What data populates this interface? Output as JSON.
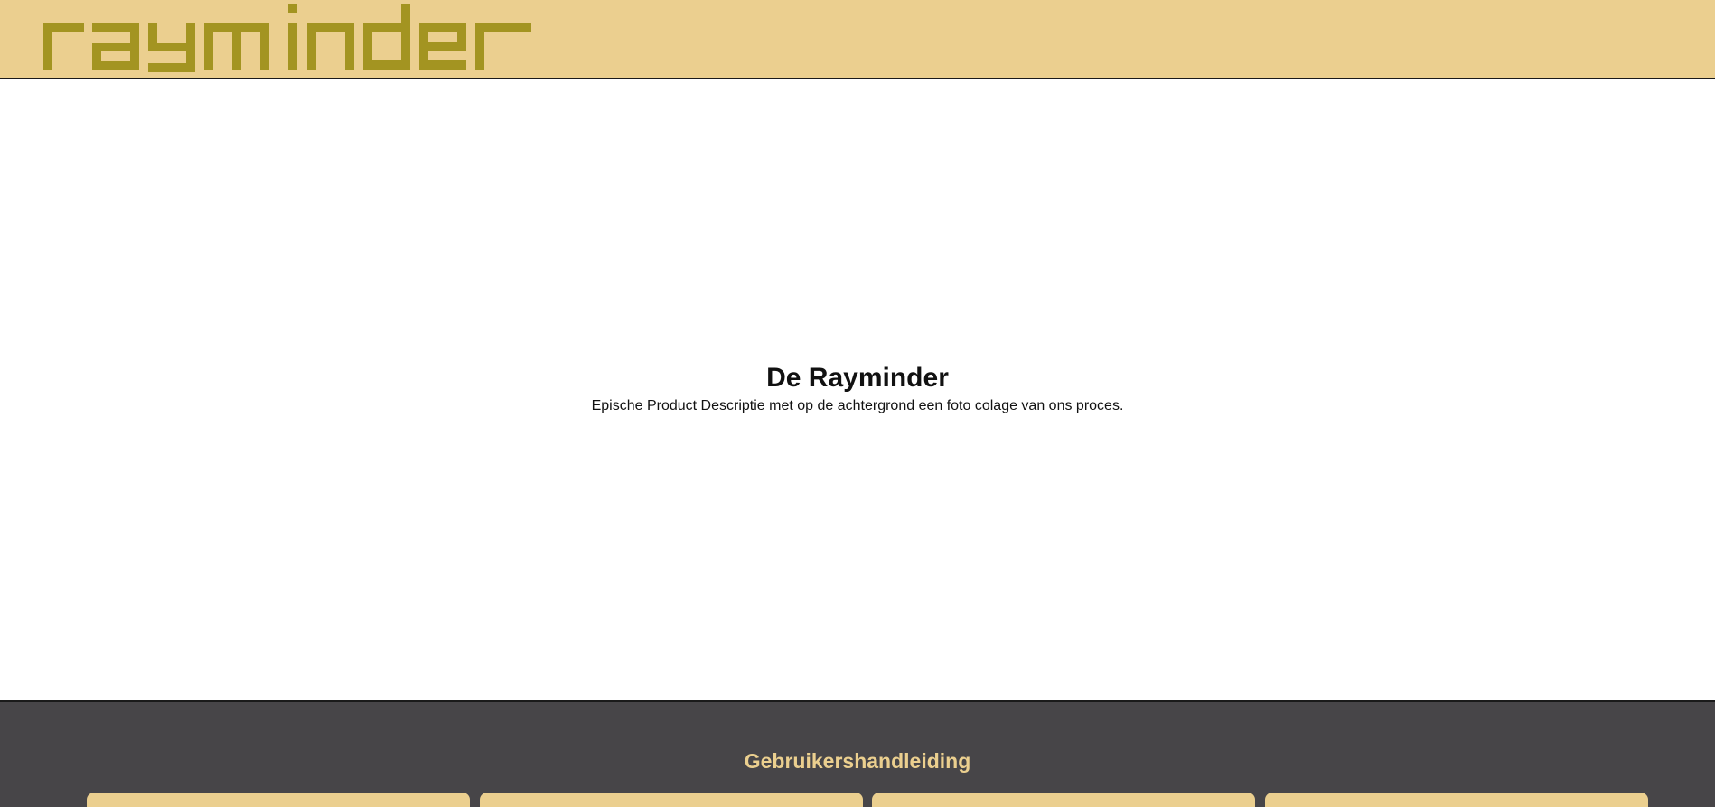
{
  "header": {
    "logo_text": "rayminder",
    "background_color": "#ebcf8f",
    "logo_color": "#a39421"
  },
  "hero": {
    "title": "De Rayminder",
    "description": "Epische Product Descriptie met op de achtergrond een foto colage van ons proces."
  },
  "footer": {
    "title": "Gebruikershandleiding",
    "background_color": "#474548",
    "accent_color": "#ebcf8f",
    "cards": [
      {
        "label": ""
      },
      {
        "label": ""
      },
      {
        "label": ""
      },
      {
        "label": ""
      }
    ]
  }
}
